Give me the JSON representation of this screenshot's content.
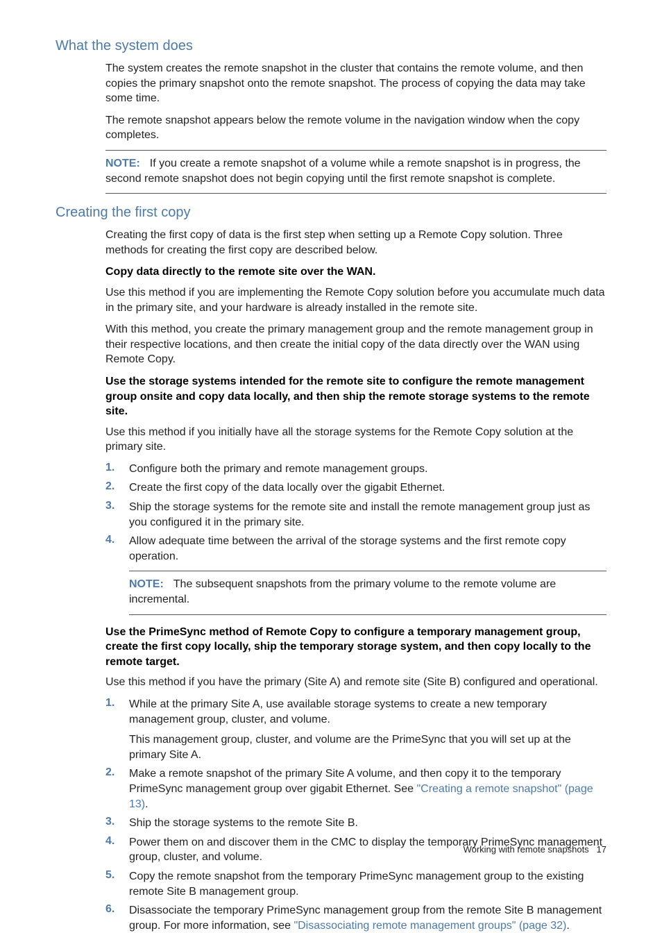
{
  "section1": {
    "heading": "What the system does",
    "p1": "The system creates the remote snapshot in the cluster that contains the remote volume, and then copies the primary snapshot onto the remote snapshot. The process of copying the data may take some time.",
    "p2": "The remote snapshot appears below the remote volume in the navigation window when the copy completes.",
    "note_label": "NOTE:",
    "note_text": "If you create a remote snapshot of a volume while a remote snapshot is in progress, the second remote snapshot does not begin copying until the first remote snapshot is complete."
  },
  "section2": {
    "heading": "Creating the first copy",
    "p1": "Creating the first copy of data is the first step when setting up a Remote Copy solution. Three methods for creating the first copy are described below.",
    "method1_title": "Copy data directly to the remote site over the WAN.",
    "method1_p1": "Use this method if you are implementing the Remote Copy solution before you accumulate much data in the primary site, and your hardware is already installed in the remote site.",
    "method1_p2": "With this method, you create the primary management group and the remote management group in their respective locations, and then create the initial copy of the data directly over the WAN using Remote Copy.",
    "method2_title": "Use the storage systems intended for the remote site to configure the remote management group onsite and copy data locally, and then ship the remote storage systems to the remote site.",
    "method2_p1": "Use this method if you initially have all the storage systems for the Remote Copy solution at the primary site.",
    "method2_list": [
      "Configure both the primary and remote management groups.",
      "Create the first copy of the data locally over the gigabit Ethernet.",
      "Ship the storage systems for the remote site and install the remote management group just as you configured it in the primary site.",
      "Allow adequate time between the arrival of the storage systems and the first remote copy operation."
    ],
    "method2_note_label": "NOTE:",
    "method2_note_text": "The subsequent snapshots from the primary volume to the remote volume are incremental.",
    "method3_title": "Use the PrimeSync method of Remote Copy to configure a temporary management group, create the first copy locally, ship the temporary storage system, and then copy locally to the remote target.",
    "method3_p1": "Use this method if you have the primary (Site A) and remote site (Site B) configured and operational.",
    "method3_list": {
      "i1_a": "While at the primary Site A, use available storage systems to create a new temporary management group, cluster, and volume.",
      "i1_b": "This management group, cluster, and volume are the PrimeSync that you will set up at the primary Site A.",
      "i2_a": "Make a remote snapshot of the primary Site A volume, and then copy it to the temporary PrimeSync management group over gigabit Ethernet. See ",
      "i2_link": "\"Creating a remote snapshot\" (page 13)",
      "i2_b": ".",
      "i3": "Ship the storage systems to the remote Site B.",
      "i4": "Power them on and discover them in the CMC to display the temporary PrimeSync management group, cluster, and volume.",
      "i5": "Copy the remote snapshot from the temporary PrimeSync management group to the existing remote Site B management group.",
      "i6_a": "Disassociate the temporary PrimeSync management group from the remote Site B management group. For more information, see ",
      "i6_link": "\"Disassociating remote management groups\" (page 32)",
      "i6_b": "."
    }
  },
  "footer": {
    "text": "Working with remote snapshots",
    "page": "17"
  },
  "nums": {
    "n1": "1.",
    "n2": "2.",
    "n3": "3.",
    "n4": "4.",
    "n5": "5.",
    "n6": "6."
  }
}
